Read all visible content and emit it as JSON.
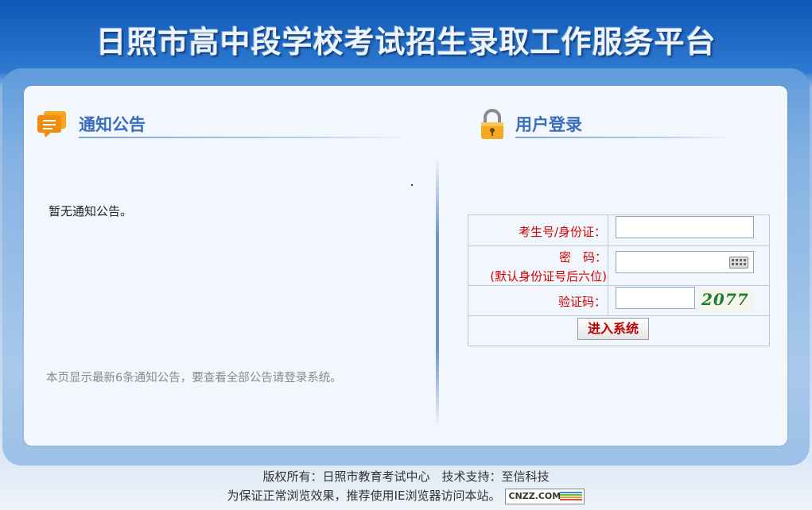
{
  "site": {
    "title": "日照市高中段学校考试招生录取工作服务平台"
  },
  "notice": {
    "title": "通知公告",
    "empty_text": "暂无通知公告。",
    "footer_text": "本页显示最新6条通知公告，要查看全部公告请登录系统。",
    "icon": "speech-bubble-icon"
  },
  "login": {
    "title": "用户登录",
    "icon": "lock-icon",
    "fields": {
      "username_label": "考生号/身份证：",
      "password_label_line1": "密　码：",
      "password_label_line2": "(默认身份证号后六位)",
      "captcha_label": "验证码："
    },
    "captcha_text": "2077",
    "submit_label": "进入系统"
  },
  "footer": {
    "line1": "版权所有：日照市教育考试中心　技术支持：至信科技",
    "line2": "为保证正常浏览效果，推荐使用IE浏览器访问本站。",
    "badge_text": "CNZZ.COM"
  },
  "colors": {
    "brand_blue": "#1a63c0",
    "label_red": "#d40000",
    "section_title": "#3a6dbb"
  }
}
